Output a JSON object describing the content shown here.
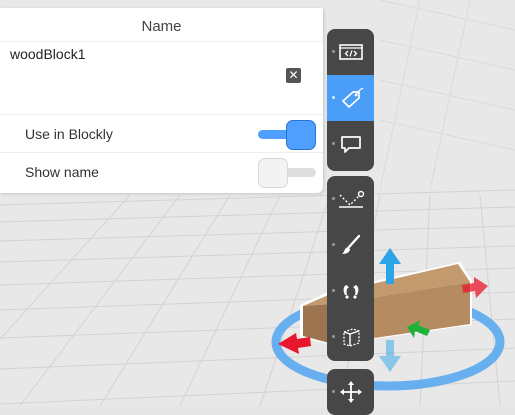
{
  "name_panel": {
    "title": "Name",
    "object_name": "woodBlock1",
    "clear_label": "✕",
    "use_in_blockly_label": "Use in Blockly",
    "use_in_blockly_on": true,
    "show_name_label": "Show name",
    "show_name_on": false
  },
  "toolbar": {
    "tools": [
      "code-tool",
      "name-tag-tool",
      "speech-bubble-tool",
      "physics-path-tool",
      "paint-brush-tool",
      "animation-tool",
      "bounding-box-tool",
      "move-tool"
    ],
    "active_tool": "name-tag-tool"
  },
  "colors": {
    "accent": "#4a9ef7",
    "toolbar_bg": "#474747",
    "scene_bg": "#e6e6e6",
    "wood": "#b08a62",
    "ring": "#5aa8ef"
  }
}
